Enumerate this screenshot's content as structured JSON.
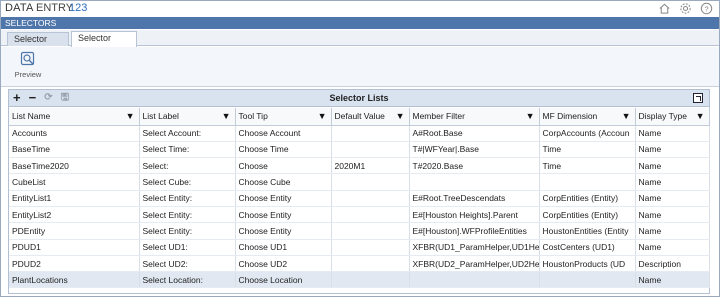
{
  "app": {
    "title_a": "DATA",
    "title_b": "ENTRY",
    "title_c": "123"
  },
  "header_icons": [
    "home-icon",
    "settings-icon",
    "help-icon"
  ],
  "section": {
    "label": "SELECTORS"
  },
  "tabs": [
    {
      "label": "Selector Bars",
      "active": false
    },
    {
      "label": "Selector Lists",
      "active": true
    }
  ],
  "toolbar": {
    "preview_label": "Preview"
  },
  "grid": {
    "title": "Selector Lists",
    "tools": {
      "add": "+",
      "remove": "−",
      "refresh": "⟳",
      "save": "🖫"
    },
    "columns": [
      "List Name",
      "List Label",
      "Tool Tip",
      "Default Value",
      "Member Filter",
      "MF Dimension",
      "Display Type"
    ],
    "rows": [
      [
        "Accounts",
        "Select Account:",
        "Choose Account",
        "",
        "A#Root.Base",
        "CorpAccounts  (Accoun",
        "Name"
      ],
      [
        "BaseTime",
        "Select Time:",
        "Choose Time",
        "",
        "T#|WFYear|.Base",
        "Time",
        "Name"
      ],
      [
        "BaseTime2020",
        "Select:",
        "Choose",
        "2020M1",
        "T#2020.Base",
        "Time",
        "Name"
      ],
      [
        "CubeList",
        "Select Cube:",
        "Choose Cube",
        "",
        "",
        "",
        "Name"
      ],
      [
        "EntityList1",
        "Select Entity:",
        "Choose Entity",
        "",
        "E#Root.TreeDescendats",
        "CorpEntities  (Entity)",
        "Name"
      ],
      [
        "EntityList2",
        "Select Entity:",
        "Choose Entity",
        "",
        "E#[Houston Heights].Parent",
        "CorpEntities  (Entity)",
        "Name"
      ],
      [
        "PDEntity",
        "Select Entity:",
        "Choose Entity",
        "",
        "E#[Houston].WFProfileEntities",
        "HoustonEntities  (Entity",
        "Name"
      ],
      [
        "PDUD1",
        "Select UD1:",
        "Choose UD1",
        "",
        "XFBR(UD1_ParamHelper,UD1Help",
        "CostCenters  (UD1)",
        "Name"
      ],
      [
        "PDUD2",
        "Select UD2:",
        "Choose UD2",
        "",
        "XFBR(UD2_ParamHelper,UD2Helpe",
        "HoustonProducts  (UD",
        "Description"
      ],
      [
        "PlantLocations",
        "Select Location:",
        "Choose Location",
        "",
        "",
        "",
        "Name"
      ]
    ]
  },
  "colors": {
    "section_bar": "#4f76aa",
    "title_accent": "#2a6ebb",
    "grid_header": "#d9e3f0"
  }
}
